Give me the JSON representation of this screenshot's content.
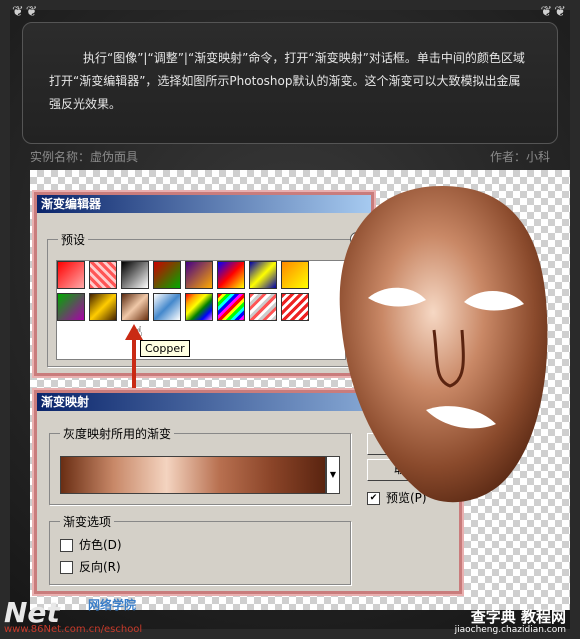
{
  "info": {
    "text": "执行“图像”|“调整”|“渐变映射”命令，打开“渐变映射”对话框。单击中间的颜色区域打开“渐变编辑器”，选择如图所示Photoshop默认的渐变。这个渐变可以大致模拟出金属强反光效果。"
  },
  "meta": {
    "example": "实例名称：虚伪面具",
    "author": "作者：小科"
  },
  "editor": {
    "title": "渐变编辑器",
    "presets_label": "预设",
    "tooltip": "Copper"
  },
  "map": {
    "title": "渐变映射",
    "group_label": "灰度映射所用的渐变",
    "options_label": "渐变选项",
    "dither": "仿色(D)",
    "reverse": "反向(R)",
    "preview": "预览(P)",
    "cancel": "取"
  },
  "watermarks": {
    "left": "Net",
    "left_sub": "网络学院",
    "left_url": "www.86Net.com.cn/eschool",
    "right": "查字典 教程网",
    "right_url": "jiaocheng.chazidian.com"
  },
  "colors": {
    "accent": "#c92a14",
    "title_start": "#0a246a",
    "title_end": "#a6caf0",
    "dialog_bg": "#d4d0c8"
  }
}
